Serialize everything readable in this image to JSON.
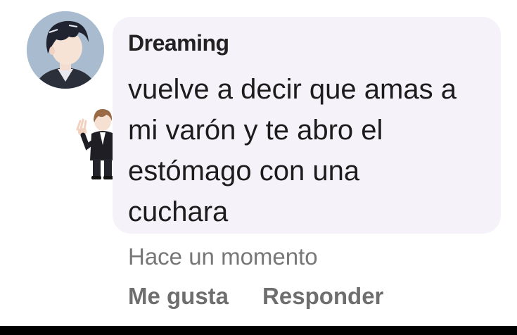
{
  "comment": {
    "author": "Dreaming",
    "text": "vuelve a decir que amas a\nmi varón y te abro el\nestómago con una\ncuchara",
    "timestamp": "Hace un momento",
    "actions": {
      "like_label": "Me gusta",
      "reply_label": "Responder"
    }
  },
  "colors": {
    "bubble_background": "#f5f2f9",
    "author_text": "#222222",
    "message_text": "#1c1c1c",
    "meta_text": "#777777"
  }
}
